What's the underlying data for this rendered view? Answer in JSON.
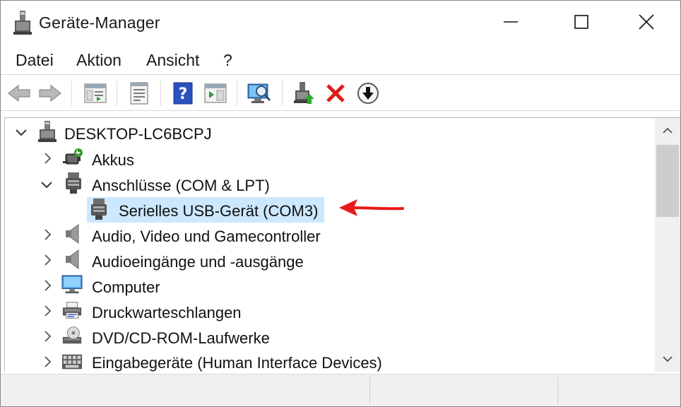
{
  "window": {
    "title": "Geräte-Manager"
  },
  "menu": {
    "items": [
      {
        "label": "Datei"
      },
      {
        "label": "Aktion"
      },
      {
        "label": "Ansicht"
      },
      {
        "label": "?"
      }
    ]
  },
  "toolbar": {
    "buttons": [
      {
        "icon": "back-arrow-icon"
      },
      {
        "icon": "forward-arrow-icon"
      },
      {
        "icon": "console-tree-icon"
      },
      {
        "icon": "properties-icon"
      },
      {
        "icon": "help-icon"
      },
      {
        "icon": "show-action-pane-icon"
      },
      {
        "icon": "scan-hardware-icon"
      },
      {
        "icon": "update-driver-icon"
      },
      {
        "icon": "uninstall-device-icon"
      },
      {
        "icon": "disable-device-icon"
      }
    ]
  },
  "tree": {
    "root": {
      "label": "DESKTOP-LC6BCPJ",
      "expanded": true
    },
    "items": [
      {
        "label": "Akkus",
        "expanded": false,
        "icon": "battery-icon"
      },
      {
        "label": "Anschlüsse (COM & LPT)",
        "expanded": true,
        "icon": "port-icon"
      },
      {
        "label": "Serielles USB-Gerät (COM3)",
        "child": true,
        "selected": true,
        "icon": "serial-port-icon"
      },
      {
        "label": "Audio, Video und Gamecontroller",
        "expanded": false,
        "icon": "speaker-icon"
      },
      {
        "label": "Audioeingänge und -ausgänge",
        "expanded": false,
        "icon": "speaker-icon"
      },
      {
        "label": "Computer",
        "expanded": false,
        "icon": "monitor-icon"
      },
      {
        "label": "Druckwarteschlangen",
        "expanded": false,
        "icon": "printer-icon"
      },
      {
        "label": "DVD/CD-ROM-Laufwerke",
        "expanded": false,
        "icon": "disc-drive-icon"
      },
      {
        "label": "Eingabegeräte (Human Interface Devices)",
        "expanded": false,
        "icon": "keyboard-icon"
      }
    ]
  },
  "colors": {
    "selection": "#cce8ff",
    "annotation": "#e81919"
  }
}
